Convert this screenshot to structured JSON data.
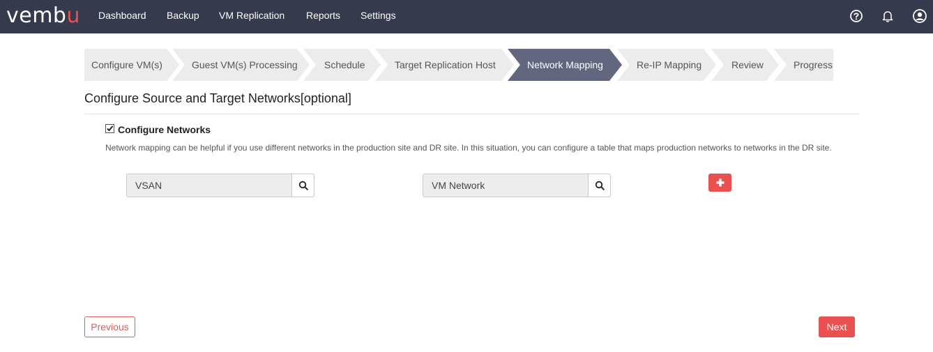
{
  "app": {
    "logo_text": "vembu",
    "accent_color": "#e8514f",
    "nav_bg": "#363a4d"
  },
  "nav": {
    "items": [
      {
        "label": "Dashboard"
      },
      {
        "label": "Backup"
      },
      {
        "label": "VM Replication"
      },
      {
        "label": "Reports"
      },
      {
        "label": "Settings"
      }
    ],
    "icons": [
      "help-icon",
      "bell-icon",
      "user-icon"
    ]
  },
  "wizard": {
    "steps": [
      {
        "label": "Configure VM(s)"
      },
      {
        "label": "Guest VM(s) Processing"
      },
      {
        "label": "Schedule"
      },
      {
        "label": "Target Replication Host"
      },
      {
        "label": "Network Mapping",
        "active": true
      },
      {
        "label": "Re-IP Mapping"
      },
      {
        "label": "Review"
      },
      {
        "label": "Progress"
      }
    ]
  },
  "main": {
    "section_title": "Configure Source and Target Networks[optional]",
    "configure_networks": {
      "label": "Configure Networks",
      "checked": true
    },
    "description": "Network mapping can be helpful if you use different networks in the production site and DR site. In this situation, you can configure a table that maps production networks to networks in the DR site.",
    "source_network": {
      "value": "VSAN"
    },
    "target_network": {
      "value": "VM Network"
    }
  },
  "footer": {
    "previous_label": "Previous",
    "next_label": "Next"
  }
}
